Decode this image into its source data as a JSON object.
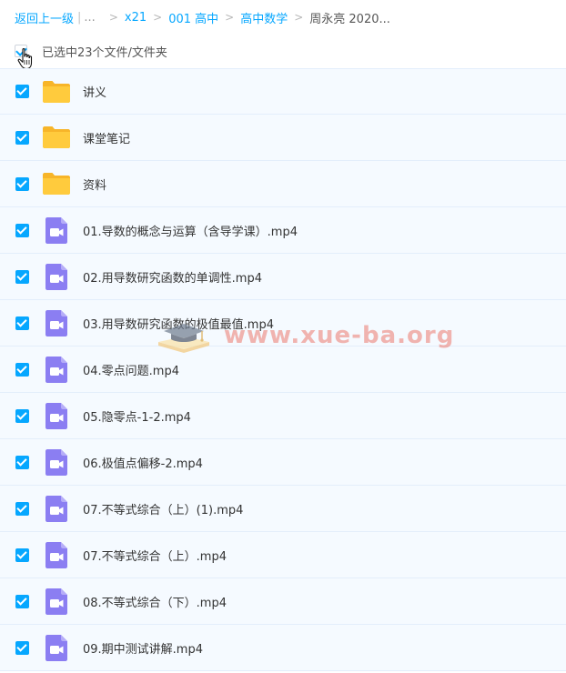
{
  "breadcrumb": {
    "back": "返回上一级",
    "ellipsis": "...",
    "items": [
      "x21",
      "001 高中",
      "高中数学"
    ],
    "current": "周永亮 2020..."
  },
  "header": {
    "selected_text": "已选中23个文件/文件夹"
  },
  "files": [
    {
      "name": "讲义",
      "type": "folder-icon"
    },
    {
      "name": "课堂笔记",
      "type": "folder-icon"
    },
    {
      "name": "资料",
      "type": "folder-icon"
    },
    {
      "name": "01.导数的概念与运算（含导学课）.mp4",
      "type": "video-file-icon"
    },
    {
      "name": "02.用导数研究函数的单调性.mp4",
      "type": "video-file-icon"
    },
    {
      "name": "03.用导数研究函数的极值最值.mp4",
      "type": "video-file-icon"
    },
    {
      "name": "04.零点问题.mp4",
      "type": "video-file-icon"
    },
    {
      "name": "05.隐零点-1-2.mp4",
      "type": "video-file-icon"
    },
    {
      "name": "06.极值点偏移-2.mp4",
      "type": "video-file-icon"
    },
    {
      "name": "07.不等式综合（上）(1).mp4",
      "type": "video-file-icon"
    },
    {
      "name": "07.不等式综合（上）.mp4",
      "type": "video-file-icon"
    },
    {
      "name": "08.不等式综合（下）.mp4",
      "type": "video-file-icon"
    },
    {
      "name": "09.期中测试讲解.mp4",
      "type": "video-file-icon"
    }
  ],
  "watermark": {
    "text": "www.xue-ba.org"
  },
  "colors": {
    "accent": "#06a7ff",
    "folder": "#ffc93b",
    "video": "#8b7ef2",
    "row_bg": "#f5faff"
  }
}
